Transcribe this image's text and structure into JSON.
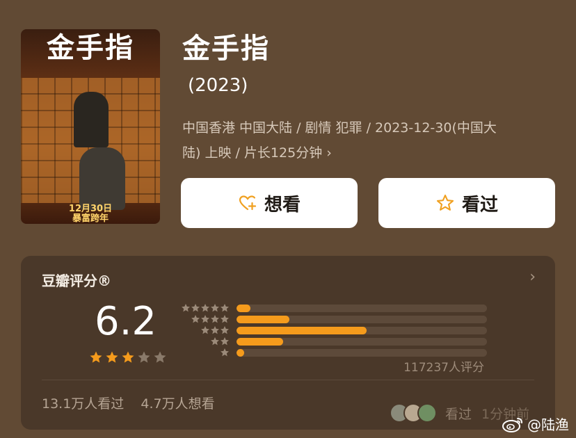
{
  "poster": {
    "title": "金手指",
    "date": "12月30日",
    "tagline": "暴富跨年"
  },
  "movie": {
    "title": "金手指",
    "year": "(2023)",
    "meta_line1": "中国香港 中国大陆 / 剧情 犯罪 / 2023-12-30(中国大",
    "meta_line2": "陆) 上映 / 片长125分钟"
  },
  "actions": {
    "want_label": "想看",
    "seen_label": "看过"
  },
  "rating": {
    "header": "豆瓣评分®",
    "score": "6.2",
    "stars": 3,
    "distribution": [
      0.055,
      0.21,
      0.52,
      0.185,
      0.03
    ],
    "count_text": "117237人评分",
    "watched_text": "13.1万人看过",
    "want_text": "4.7万人想看",
    "friends_seen": "看过",
    "friends_score": "1分钟前"
  },
  "watermark": {
    "handle": "@陆渔"
  },
  "colors": {
    "background": "#614a34",
    "card": "#4a3829",
    "accent": "#f59b1c",
    "button_bg": "#ffffff"
  }
}
